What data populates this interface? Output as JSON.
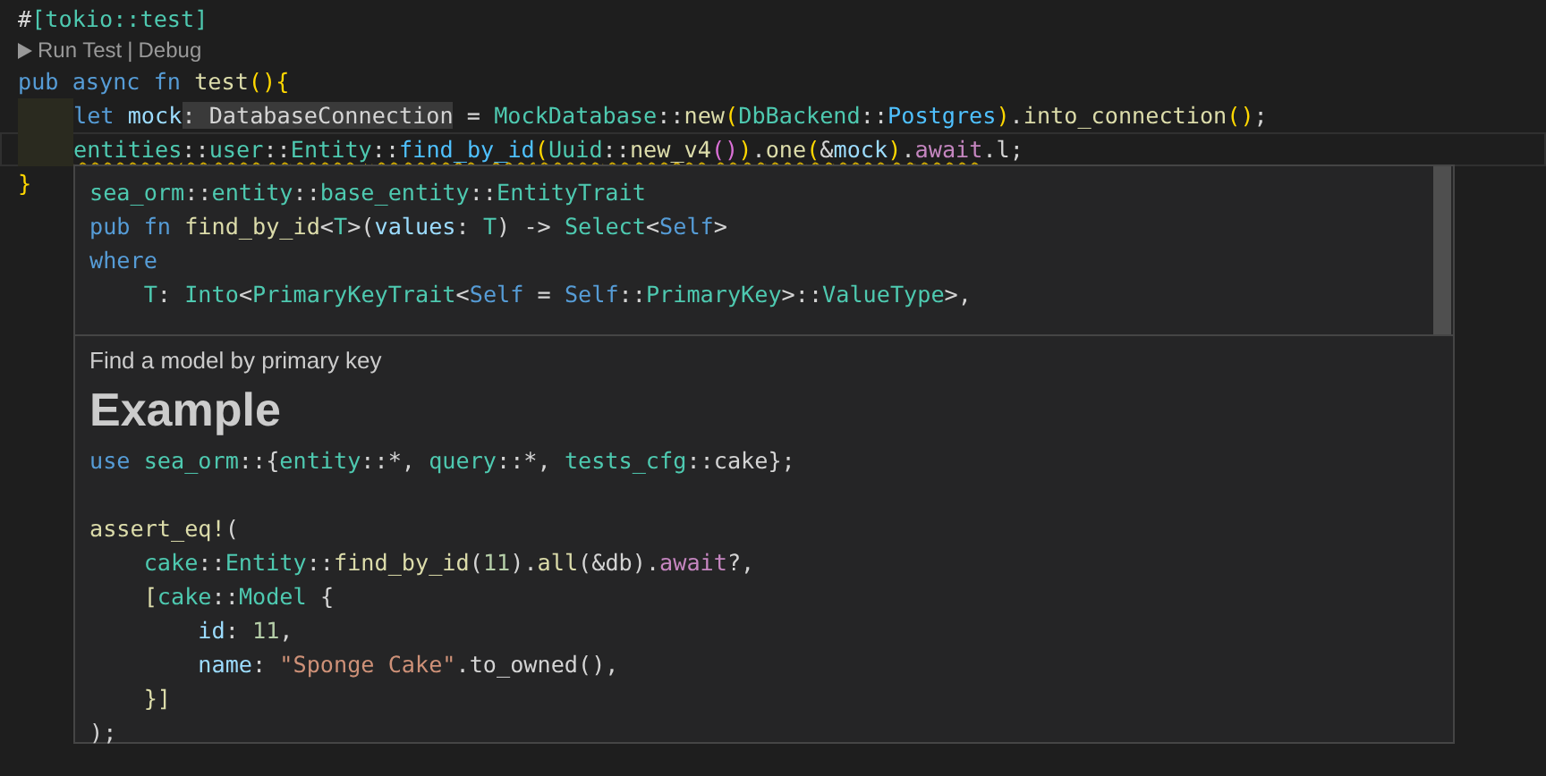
{
  "editor": {
    "lines": [
      {
        "tokens": [
          {
            "text": "#",
            "kind": "plain"
          },
          {
            "text": "[tokio::test]",
            "kind": "attr"
          }
        ]
      },
      {
        "tokens": [
          {
            "text": "pub async fn ",
            "kind": "kw"
          },
          {
            "text": "test",
            "kind": "fn"
          },
          {
            "text": "()",
            "kind": "br1"
          },
          {
            "text": "{",
            "kind": "br1"
          }
        ]
      },
      {
        "indented": true,
        "tokens": [
          {
            "text": "let ",
            "kind": "kw"
          },
          {
            "text": "mock",
            "kind": "var"
          },
          {
            "text": ": DatabaseConnection",
            "kind": "hint"
          },
          {
            "text": " = ",
            "kind": "plain"
          },
          {
            "text": "MockDatabase",
            "kind": "type"
          },
          {
            "text": "::",
            "kind": "plain"
          },
          {
            "text": "new",
            "kind": "fn"
          },
          {
            "text": "(",
            "kind": "br1"
          },
          {
            "text": "DbBackend",
            "kind": "type"
          },
          {
            "text": "::",
            "kind": "plain"
          },
          {
            "text": "Postgres",
            "kind": "enum"
          },
          {
            "text": ")",
            "kind": "br1"
          },
          {
            "text": ".",
            "kind": "plain"
          },
          {
            "text": "into_connection",
            "kind": "fn"
          },
          {
            "text": "()",
            "kind": "br1"
          },
          {
            "text": ";",
            "kind": "plain"
          }
        ]
      },
      {
        "indented": true,
        "current": true,
        "tokens": [
          {
            "text": "entities",
            "kind": "type",
            "squiggly": true
          },
          {
            "text": "::",
            "kind": "plain",
            "squiggly": true
          },
          {
            "text": "user",
            "kind": "type",
            "squiggly": true
          },
          {
            "text": "::",
            "kind": "plain",
            "squiggly": true
          },
          {
            "text": "Entity",
            "kind": "type",
            "squiggly": true
          },
          {
            "text": "::",
            "kind": "plain",
            "squiggly": true
          },
          {
            "text": "find_by_id",
            "kind": "link",
            "squiggly": true
          },
          {
            "text": "(",
            "kind": "br1",
            "squiggly": true
          },
          {
            "text": "Uuid",
            "kind": "type",
            "squiggly": true
          },
          {
            "text": "::",
            "kind": "plain",
            "squiggly": true
          },
          {
            "text": "new_v4",
            "kind": "fn",
            "squiggly": true
          },
          {
            "text": "()",
            "kind": "br2",
            "squiggly": true
          },
          {
            "text": ")",
            "kind": "br1",
            "squiggly": true
          },
          {
            "text": ".",
            "kind": "plain",
            "squiggly": true
          },
          {
            "text": "one",
            "kind": "fn",
            "squiggly": true
          },
          {
            "text": "(",
            "kind": "br1",
            "squiggly": true
          },
          {
            "text": "&",
            "kind": "plain",
            "squiggly": true
          },
          {
            "text": "mock",
            "kind": "var",
            "squiggly": true
          },
          {
            "text": ")",
            "kind": "br1",
            "squiggly": true
          },
          {
            "text": ".",
            "kind": "plain",
            "squiggly": true
          },
          {
            "text": "await",
            "kind": "ctrl",
            "squiggly": true
          },
          {
            "text": ".l;",
            "kind": "plain",
            "squiggly": false
          }
        ]
      },
      {
        "tokens": [
          {
            "text": "}",
            "kind": "br1"
          }
        ]
      }
    ],
    "codelens": {
      "run": "Run Test",
      "separator": "|",
      "debug": "Debug"
    }
  },
  "hover": {
    "signature": [
      {
        "tokens": [
          {
            "text": "sea_orm",
            "kind": "type"
          },
          {
            "text": "::",
            "kind": "plain"
          },
          {
            "text": "entity",
            "kind": "type"
          },
          {
            "text": "::",
            "kind": "plain"
          },
          {
            "text": "base_entity",
            "kind": "type"
          },
          {
            "text": "::",
            "kind": "plain"
          },
          {
            "text": "EntityTrait",
            "kind": "type"
          }
        ]
      },
      {
        "tokens": [
          {
            "text": "pub fn ",
            "kind": "kw"
          },
          {
            "text": "find_by_id",
            "kind": "fn"
          },
          {
            "text": "<",
            "kind": "plain"
          },
          {
            "text": "T",
            "kind": "type"
          },
          {
            "text": ">(",
            "kind": "plain"
          },
          {
            "text": "values",
            "kind": "var"
          },
          {
            "text": ": ",
            "kind": "plain"
          },
          {
            "text": "T",
            "kind": "type"
          },
          {
            "text": ") -> ",
            "kind": "plain"
          },
          {
            "text": "Select",
            "kind": "type"
          },
          {
            "text": "<",
            "kind": "plain"
          },
          {
            "text": "Self",
            "kind": "kw"
          },
          {
            "text": ">",
            "kind": "plain"
          }
        ]
      },
      {
        "tokens": [
          {
            "text": "where",
            "kind": "kw"
          }
        ]
      },
      {
        "tokens": [
          {
            "text": "    T",
            "kind": "type"
          },
          {
            "text": ": ",
            "kind": "plain"
          },
          {
            "text": "Into",
            "kind": "type"
          },
          {
            "text": "<",
            "kind": "plain"
          },
          {
            "text": "PrimaryKeyTrait",
            "kind": "type"
          },
          {
            "text": "<",
            "kind": "plain"
          },
          {
            "text": "Self",
            "kind": "kw"
          },
          {
            "text": " = ",
            "kind": "plain"
          },
          {
            "text": "Self",
            "kind": "kw"
          },
          {
            "text": "::",
            "kind": "plain"
          },
          {
            "text": "PrimaryKey",
            "kind": "type"
          },
          {
            "text": ">::",
            "kind": "plain"
          },
          {
            "text": "ValueType",
            "kind": "type"
          },
          {
            "text": ">,",
            "kind": "plain"
          }
        ]
      }
    ],
    "description": "Find a model by primary key",
    "heading": "Example",
    "example_blocks": [
      [
        {
          "tokens": [
            {
              "text": "use ",
              "kind": "kw"
            },
            {
              "text": "sea_orm",
              "kind": "type"
            },
            {
              "text": "::{",
              "kind": "plain"
            },
            {
              "text": "entity",
              "kind": "type"
            },
            {
              "text": "::*, ",
              "kind": "plain"
            },
            {
              "text": "query",
              "kind": "type"
            },
            {
              "text": "::*, ",
              "kind": "plain"
            },
            {
              "text": "tests_cfg",
              "kind": "type"
            },
            {
              "text": "::",
              "kind": "plain"
            },
            {
              "text": "cake",
              "kind": "plain"
            },
            {
              "text": "};",
              "kind": "plain"
            }
          ]
        }
      ],
      [
        {
          "tokens": [
            {
              "text": "assert_eq!",
              "kind": "fn"
            },
            {
              "text": "(",
              "kind": "plain"
            }
          ]
        },
        {
          "tokens": [
            {
              "text": "    cake",
              "kind": "type"
            },
            {
              "text": "::",
              "kind": "plain"
            },
            {
              "text": "Entity",
              "kind": "type"
            },
            {
              "text": "::",
              "kind": "plain"
            },
            {
              "text": "find_by_id",
              "kind": "fn"
            },
            {
              "text": "(",
              "kind": "plain"
            },
            {
              "text": "11",
              "kind": "num"
            },
            {
              "text": ").",
              "kind": "plain"
            },
            {
              "text": "all",
              "kind": "fn"
            },
            {
              "text": "(&db).",
              "kind": "plain"
            },
            {
              "text": "await",
              "kind": "ctrl"
            },
            {
              "text": "?,",
              "kind": "plain"
            }
          ]
        },
        {
          "tokens": [
            {
              "text": "    [",
              "kind": "fn"
            },
            {
              "text": "cake",
              "kind": "type"
            },
            {
              "text": "::",
              "kind": "plain"
            },
            {
              "text": "Model",
              "kind": "type"
            },
            {
              "text": " {",
              "kind": "plain"
            }
          ]
        },
        {
          "tokens": [
            {
              "text": "        id",
              "kind": "var"
            },
            {
              "text": ": ",
              "kind": "plain"
            },
            {
              "text": "11",
              "kind": "num"
            },
            {
              "text": ",",
              "kind": "plain"
            }
          ]
        },
        {
          "tokens": [
            {
              "text": "        name",
              "kind": "var"
            },
            {
              "text": ": ",
              "kind": "plain"
            },
            {
              "text": "\"Sponge Cake\"",
              "kind": "str"
            },
            {
              "text": ".to_owned(),",
              "kind": "plain"
            }
          ]
        },
        {
          "tokens": [
            {
              "text": "    }]",
              "kind": "fn"
            }
          ]
        },
        {
          "tokens": [
            {
              "text": ");",
              "kind": "plain"
            }
          ]
        }
      ]
    ]
  }
}
